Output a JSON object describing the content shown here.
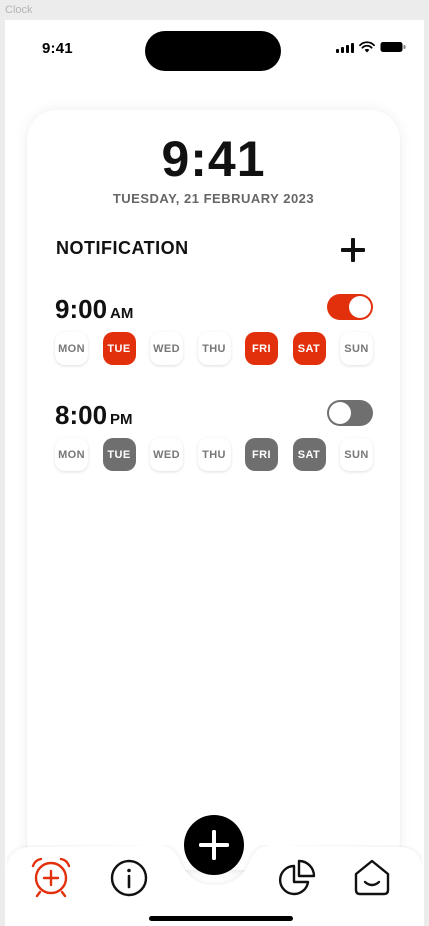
{
  "frame": {
    "label": "Clock"
  },
  "status_bar": {
    "time": "9:41"
  },
  "clock": {
    "time": "9:41",
    "date": "TUESDAY, 21 FEBRUARY 2023"
  },
  "notifications": {
    "title": "NOTIFICATION",
    "alarms": [
      {
        "time": "9:00",
        "ampm": "AM",
        "enabled": true,
        "days": [
          {
            "label": "MON",
            "active": false
          },
          {
            "label": "TUE",
            "active": true
          },
          {
            "label": "WED",
            "active": false
          },
          {
            "label": "THU",
            "active": false
          },
          {
            "label": "FRI",
            "active": true
          },
          {
            "label": "SAT",
            "active": true
          },
          {
            "label": "SUN",
            "active": false
          }
        ]
      },
      {
        "time": "8:00",
        "ampm": "PM",
        "enabled": false,
        "days": [
          {
            "label": "MON",
            "active": false
          },
          {
            "label": "TUE",
            "active": true
          },
          {
            "label": "WED",
            "active": false
          },
          {
            "label": "THU",
            "active": false
          },
          {
            "label": "FRI",
            "active": true
          },
          {
            "label": "SAT",
            "active": true
          },
          {
            "label": "SUN",
            "active": false
          }
        ]
      }
    ]
  },
  "bottom_nav": {
    "items": [
      {
        "icon": "alarm-add-icon",
        "active": true
      },
      {
        "icon": "info-icon",
        "active": false
      },
      {
        "icon": "add-icon",
        "active": false
      },
      {
        "icon": "pie-chart-icon",
        "active": false
      },
      {
        "icon": "home-icon",
        "active": false
      }
    ]
  },
  "colors": {
    "accent": "#e2300c",
    "inactive": "#6f6f6f",
    "text": "#111111",
    "muted": "#666666"
  }
}
